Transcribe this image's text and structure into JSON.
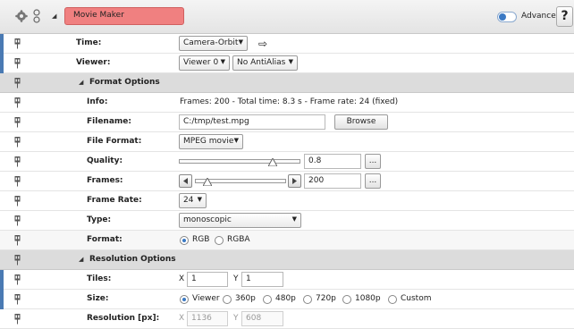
{
  "header": {
    "module_name": "Movie Maker",
    "advanced_label": "Advanced",
    "help_label": "?",
    "icons": [
      "gear-icon",
      "link-icon",
      "collapse-triangle-icon"
    ]
  },
  "time": {
    "label": "Time:",
    "value": "Camera-Orbit"
  },
  "viewer": {
    "label": "Viewer:",
    "viewer_value": "Viewer 0",
    "antialias_value": "No AntiAlias"
  },
  "format_options": {
    "title": "Format Options",
    "info": {
      "label": "Info:",
      "value": "Frames: 200 - Total time: 8.3 s - Frame rate: 24 (fixed)"
    },
    "filename": {
      "label": "Filename:",
      "value": "C:/tmp/test.mpg",
      "browse_label": "Browse"
    },
    "file_format": {
      "label": "File Format:",
      "value": "MPEG movie"
    },
    "quality": {
      "label": "Quality:",
      "value": "0.8",
      "level": 0.8,
      "more_label": "..."
    },
    "frames": {
      "label": "Frames:",
      "value": "200",
      "more_label": "..."
    },
    "frame_rate": {
      "label": "Frame Rate:",
      "value": "24"
    },
    "type": {
      "label": "Type:",
      "value": "monoscopic"
    },
    "format": {
      "label": "Format:",
      "options": [
        "RGB",
        "RGBA"
      ],
      "selected": "RGB"
    }
  },
  "resolution_options": {
    "title": "Resolution Options",
    "tiles": {
      "label": "Tiles:",
      "x_label": "X",
      "x_value": "1",
      "y_label": "Y",
      "y_value": "1"
    },
    "size": {
      "label": "Size:",
      "options": [
        "Viewer",
        "360p",
        "480p",
        "720p",
        "1080p",
        "Custom"
      ],
      "selected": "Viewer"
    },
    "resolution": {
      "label": "Resolution [px]:",
      "x_label": "X",
      "x_value": "1136",
      "y_label": "Y",
      "y_value": "608"
    }
  },
  "colors": {
    "module_name_bg": "#f08080",
    "group_bg": "#dcdcdc",
    "accent": "#3b79c4",
    "strip": "#4a7ab3"
  }
}
